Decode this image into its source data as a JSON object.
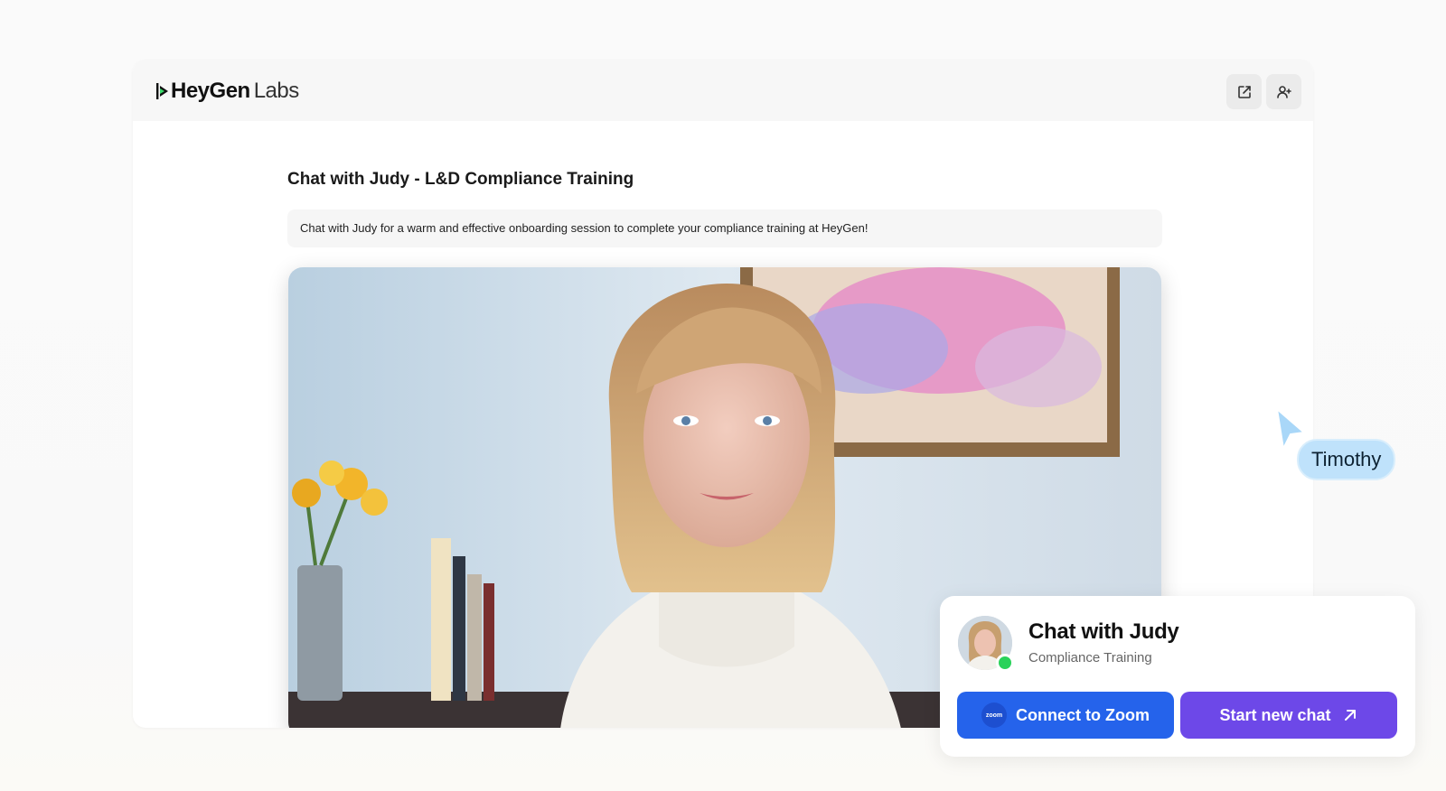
{
  "app": {
    "brand": "HeyGen",
    "brand_suffix": "Labs"
  },
  "toolbar": {
    "open_external_icon": "external-link-icon",
    "add_user_icon": "user-plus-icon"
  },
  "page": {
    "title": "Chat with Judy - L&D Compliance Training",
    "description": "Chat with Judy for a warm and effective onboarding session to complete your compliance training at HeyGen!"
  },
  "cursor": {
    "user_name": "Timothy"
  },
  "card": {
    "title": "Chat with Judy",
    "subtitle": "Compliance Training",
    "status": "online",
    "zoom_logo_text": "zoom",
    "connect_button": "Connect to Zoom",
    "new_chat_button": "Start new chat"
  },
  "colors": {
    "zoom_blue": "#2563eb",
    "purple": "#6d48e8",
    "online": "#2ad25a",
    "cursor_tag": "#bfe2fb"
  }
}
